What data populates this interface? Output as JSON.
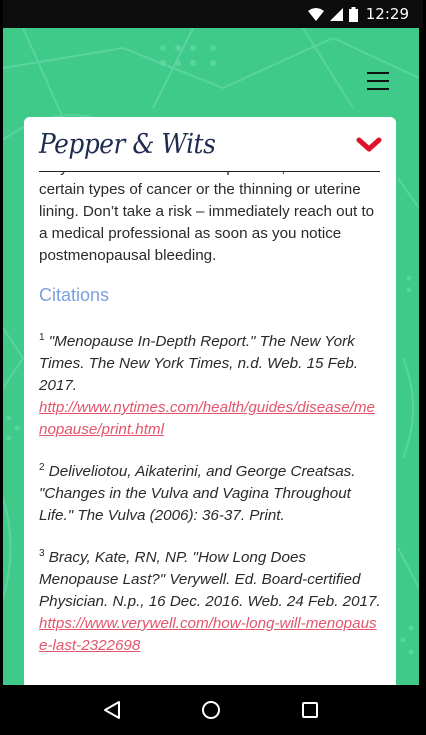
{
  "status_bar": {
    "time": "12:29"
  },
  "header": {
    "logo_text": "Pepper & Wits"
  },
  "article": {
    "paragraph": "may also indicate a serious problem, such as certain types of cancer or the thinning or uterine lining. Don’t take a risk – immediately reach out to a medical professional as soon as you notice postmenopausal bleeding.",
    "citations_title": "Citations",
    "citations": [
      {
        "number": "1",
        "text": " \"Menopause In-Depth Report.\" The New York Times. The New York Times, n.d. Web. 15 Feb. 2017.",
        "link": "http://www.nytimes.com/health/guides/disease/menopause/print.html"
      },
      {
        "number": "2",
        "text": " Deliveliotou, Aikaterini, and George Creatsas. \"Changes in the Vulva and Vagina Throughout Life.\" The Vulva (2006): 36-37. Print.",
        "link": ""
      },
      {
        "number": "3",
        "text": " Bracy, Kate, RN, NP. \"How Long Does Menopause Last?\" Verywell. Ed. Board-certified Physician. N.p., 16 Dec. 2016. Web. 24 Feb. 2017.",
        "link": "https://www.verywell.com/how-long-will-menopause-last-2322698"
      }
    ]
  },
  "colors": {
    "background_green": "#3fca8a",
    "chevron_red": "#e0112b",
    "link_red": "#e2556b",
    "citations_blue": "#7b9fe0",
    "logo_navy": "#1d2b4e"
  },
  "icons": {
    "wifi": "wifi-icon",
    "signal": "signal-icon",
    "battery": "battery-icon",
    "menu": "hamburger-menu-icon",
    "collapse": "chevron-down-icon",
    "back": "back-triangle-icon",
    "home": "home-circle-icon",
    "recents": "recents-square-icon"
  }
}
